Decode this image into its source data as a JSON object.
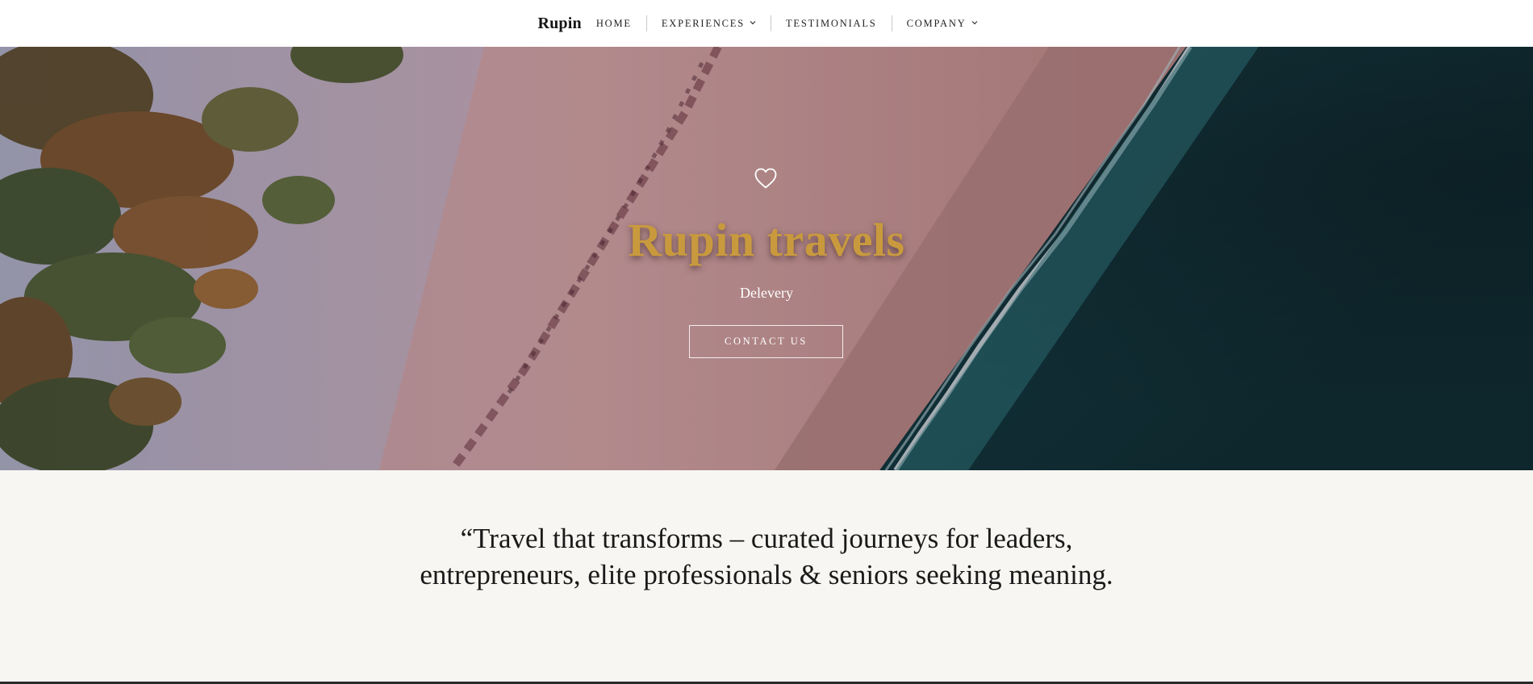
{
  "nav": {
    "brand": "Rupin",
    "items": [
      {
        "label": "HOME",
        "has_dropdown": false
      },
      {
        "label": "EXPERIENCES",
        "has_dropdown": true
      },
      {
        "label": "TESTIMONIALS",
        "has_dropdown": false
      },
      {
        "label": "COMPANY",
        "has_dropdown": true
      }
    ]
  },
  "hero": {
    "icon": "heart-outline-icon",
    "title": "Rupin travels",
    "subtitle": "Delevery",
    "cta_label": "CONTACT US",
    "title_color": "#c99a3d"
  },
  "quote": {
    "text": "“Travel that transforms – curated journeys for leaders, entrepreneurs, elite professionals & seniors seeking meaning."
  },
  "colors": {
    "nav_background": "#ffffff",
    "page_background": "#f7f6f2",
    "text": "#1a1a1a"
  }
}
